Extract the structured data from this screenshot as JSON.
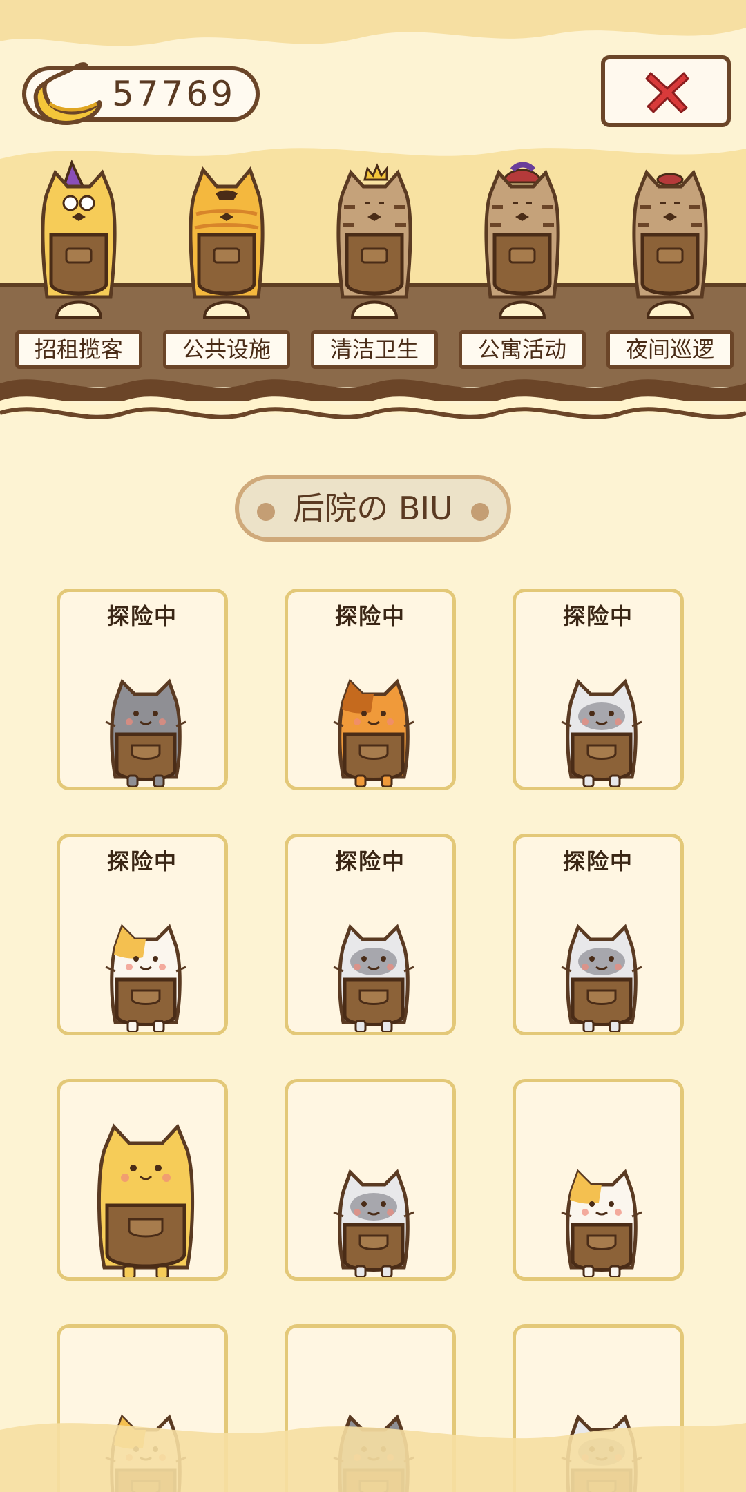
{
  "header": {
    "banana_count": "57769",
    "banana_icon": "banana-icon",
    "close_icon": "close-x-icon"
  },
  "staff": [
    {
      "label": "招租揽客",
      "hat": "party-hat",
      "fur": "yellow"
    },
    {
      "label": "公共设施",
      "hat": "none",
      "fur": "orange-striped"
    },
    {
      "label": "清洁卫生",
      "hat": "crown",
      "fur": "brown-tabby"
    },
    {
      "label": "公寓活动",
      "hat": "jester-hat",
      "fur": "brown-tabby"
    },
    {
      "label": "夜间巡逻",
      "hat": "beret",
      "fur": "brown-tabby"
    }
  ],
  "section_title": "后院の BIU",
  "cats": [
    {
      "status": "探险中",
      "fur": "gray"
    },
    {
      "status": "探险中",
      "fur": "orange-tabby"
    },
    {
      "status": "探险中",
      "fur": "silver-mask"
    },
    {
      "status": "探险中",
      "fur": "calico"
    },
    {
      "status": "探险中",
      "fur": "silver-mask"
    },
    {
      "status": "探险中",
      "fur": "silver-mask"
    },
    {
      "status": "",
      "fur": "yellow"
    },
    {
      "status": "",
      "fur": "silver-mask"
    },
    {
      "status": "",
      "fur": "calico"
    },
    {
      "status": "",
      "fur": "calico"
    },
    {
      "status": "",
      "fur": "gray"
    },
    {
      "status": "",
      "fur": "silver-mask"
    }
  ],
  "colors": {
    "background": "#fdf3d3",
    "outline": "#6b4528",
    "card_border": "#e3c878",
    "close_red": "#d83a3a",
    "apron": "#8c6238"
  }
}
